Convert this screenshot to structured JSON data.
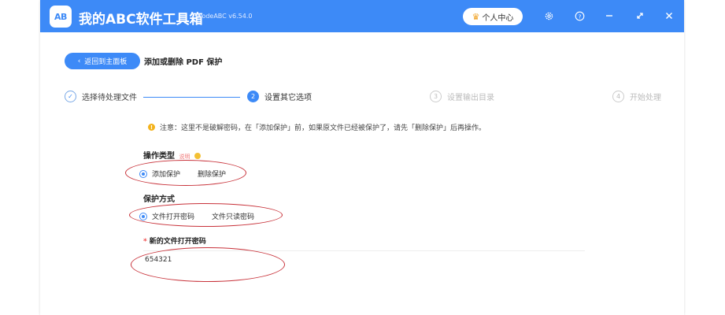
{
  "titlebar": {
    "logo_text": "AB",
    "app_title": "我的ABC软件工具箱",
    "version": "WodeABC v6.54.0",
    "user_center": "个人中心",
    "icons": [
      "gear-icon",
      "help-icon",
      "minimize-icon",
      "restore-icon",
      "close-icon"
    ],
    "accent": "#3d8af7"
  },
  "header": {
    "back_label": "返回到主面板",
    "page_title": "添加或删除 PDF 保护"
  },
  "steps": [
    {
      "label": "选择待处理文件",
      "marker": "✓"
    },
    {
      "label": "设置其它选项",
      "marker": "2"
    },
    {
      "label": "设置输出目录",
      "marker": "3"
    },
    {
      "label": "开始处理",
      "marker": "4"
    }
  ],
  "notice": "注意：这里不是破解密码，在「添加保护」前，如果原文件已经被保护了，请先「删除保护」后再操作。",
  "operation": {
    "label": "操作类型",
    "hint": "说明",
    "options": [
      "添加保护",
      "删除保护"
    ],
    "selected": "添加保护"
  },
  "protection": {
    "label": "保护方式",
    "options": [
      "文件打开密码",
      "文件只读密码"
    ],
    "selected": "文件打开密码"
  },
  "password": {
    "label": "新的文件打开密码",
    "value": "654321"
  },
  "annotation_color": "#c8323a"
}
